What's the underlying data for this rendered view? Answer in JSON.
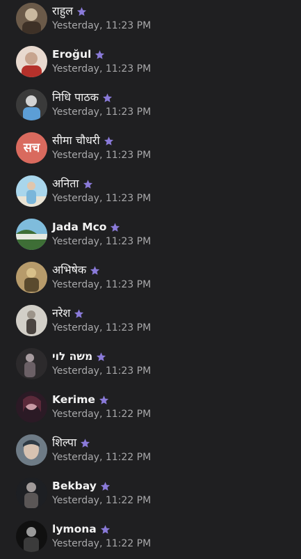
{
  "colors": {
    "background": "#1f1f21",
    "star": "#8a7ad9",
    "name": "#f2f2f2",
    "time": "#a8a8aa",
    "initials_avatar": "#d96a5e"
  },
  "contacts": [
    {
      "name": "राहुल",
      "time": "Yesterday, 11:23 PM",
      "avatar_kind": "photo",
      "avatar_palette": [
        "#6b5a49",
        "#c9b89f",
        "#3e3127"
      ]
    },
    {
      "name": "Eroğul",
      "time": "Yesterday, 11:23 PM",
      "avatar_kind": "photo",
      "avatar_palette": [
        "#c7a48f",
        "#b5312b",
        "#e8d9cf"
      ]
    },
    {
      "name": "निधि पाठक",
      "time": "Yesterday, 11:23 PM",
      "avatar_kind": "photo",
      "avatar_palette": [
        "#3a3a3a",
        "#5c9ed6",
        "#d3d3d3"
      ]
    },
    {
      "name": "सीमा चौधरी",
      "time": "Yesterday, 11:23 PM",
      "avatar_kind": "initials",
      "initials": "सच"
    },
    {
      "name": "अनिता",
      "time": "Yesterday, 11:23 PM",
      "avatar_kind": "photo",
      "avatar_palette": [
        "#a9d6ec",
        "#7ab6da",
        "#e9e3d4"
      ]
    },
    {
      "name": "Jada Mco",
      "time": "Yesterday, 11:23 PM",
      "avatar_kind": "photo",
      "avatar_palette": [
        "#7fbcdc",
        "#e6e9e0",
        "#3e6e36"
      ]
    },
    {
      "name": "अभिषेक",
      "time": "Yesterday, 11:23 PM",
      "avatar_kind": "photo",
      "avatar_palette": [
        "#b79b6b",
        "#d8c08a",
        "#5a4a2e"
      ]
    },
    {
      "name": "नरेश",
      "time": "Yesterday, 11:23 PM",
      "avatar_kind": "photo",
      "avatar_palette": [
        "#9c948a",
        "#d2cfc8",
        "#4a4440"
      ]
    },
    {
      "name": "משה לוי",
      "time": "Yesterday, 11:23 PM",
      "avatar_kind": "photo",
      "avatar_palette": [
        "#2c2a2c",
        "#6b6066",
        "#a89ca0"
      ]
    },
    {
      "name": "Kerime",
      "time": "Yesterday, 11:22 PM",
      "avatar_kind": "photo",
      "avatar_palette": [
        "#5b2a3a",
        "#2b1a25",
        "#c99aa4"
      ]
    },
    {
      "name": "शिल्पा",
      "time": "Yesterday, 11:22 PM",
      "avatar_kind": "photo",
      "avatar_palette": [
        "#6e7b86",
        "#d7c2b1",
        "#2f3a44"
      ]
    },
    {
      "name": "Bekbay",
      "time": "Yesterday, 11:22 PM",
      "avatar_kind": "photo",
      "avatar_palette": [
        "#1d1f23",
        "#5a5656",
        "#a09a99"
      ]
    },
    {
      "name": "lymona",
      "time": "Yesterday, 11:22 PM",
      "avatar_kind": "photo",
      "avatar_palette": [
        "#101010",
        "#3b3b3b",
        "#9a9a9a"
      ]
    }
  ]
}
